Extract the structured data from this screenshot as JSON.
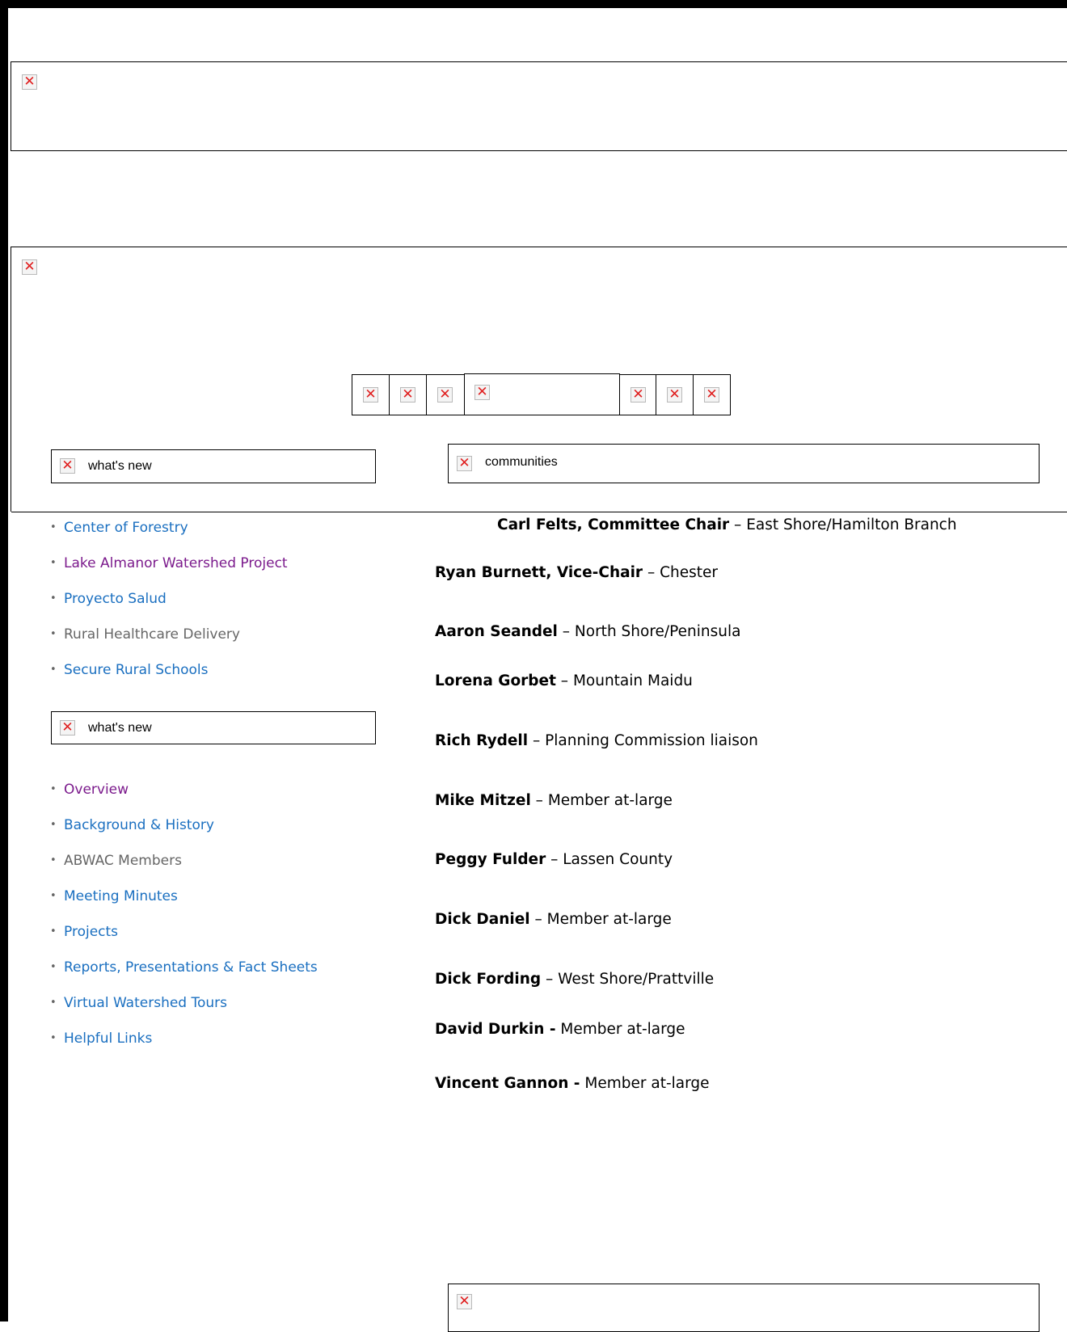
{
  "top_nav": {
    "whats_new_label": "what's new",
    "communities_label": "communities"
  },
  "site_nav": [
    {
      "label": "Center of Forestry",
      "state": "link"
    },
    {
      "label": "Lake Almanor Watershed Project",
      "state": "visited"
    },
    {
      "label": "Proyecto Salud",
      "state": "link"
    },
    {
      "label": "Rural Healthcare Delivery",
      "state": "current"
    },
    {
      "label": "Secure Rural Schools",
      "state": "link"
    }
  ],
  "sidebar": {
    "whats_new_label": "what's new",
    "items": [
      {
        "label": "Overview",
        "state": "visited"
      },
      {
        "label": "Background & History",
        "state": "link"
      },
      {
        "label": "ABWAC Members",
        "state": "current"
      },
      {
        "label": "Meeting Minutes",
        "state": "link"
      },
      {
        "label": "Projects",
        "state": "link"
      },
      {
        "label": "Reports, Presentations & Fact Sheets",
        "state": "link"
      },
      {
        "label": "Virtual Watershed Tours",
        "state": "link"
      },
      {
        "label": "Helpful Links",
        "state": "link"
      }
    ]
  },
  "members": [
    {
      "name": "Carl Felts, Committee Chair",
      "sep": " – ",
      "role": "East Shore/Hamilton Branch"
    },
    {
      "name": "Ryan Burnett, Vice-Chair",
      "sep": " – ",
      "role": "Chester"
    },
    {
      "name": "Aaron Seandel",
      "sep": " – ",
      "role": "North Shore/Peninsula"
    },
    {
      "name": "Lorena Gorbet",
      "sep": " – ",
      "role": "Mountain Maidu"
    },
    {
      "name": "Rich Rydell",
      "sep": " – ",
      "role": "Planning Commission liaison"
    },
    {
      "name": "Mike Mitzel",
      "sep": " – ",
      "role": "Member at-large"
    },
    {
      "name": "Peggy Fulder",
      "sep": " – ",
      "role": "Lassen County"
    },
    {
      "name": "Dick Daniel",
      "sep": " – ",
      "role": "Member at-large"
    },
    {
      "name": "Dick Fording",
      "sep": " – ",
      "role": "West Shore/Prattville"
    },
    {
      "name": "David Durkin -",
      "sep": " ",
      "role": "Member at-large"
    },
    {
      "name": "Vincent Gannon -",
      "sep": " ",
      "role": "Member at-large"
    }
  ],
  "colors": {
    "link": "#1a6fc0",
    "visited": "#7b1a8c",
    "current": "#666666",
    "broken_image_x": "#e01f1f"
  },
  "icons": {
    "broken_image": "broken-image-icon"
  }
}
